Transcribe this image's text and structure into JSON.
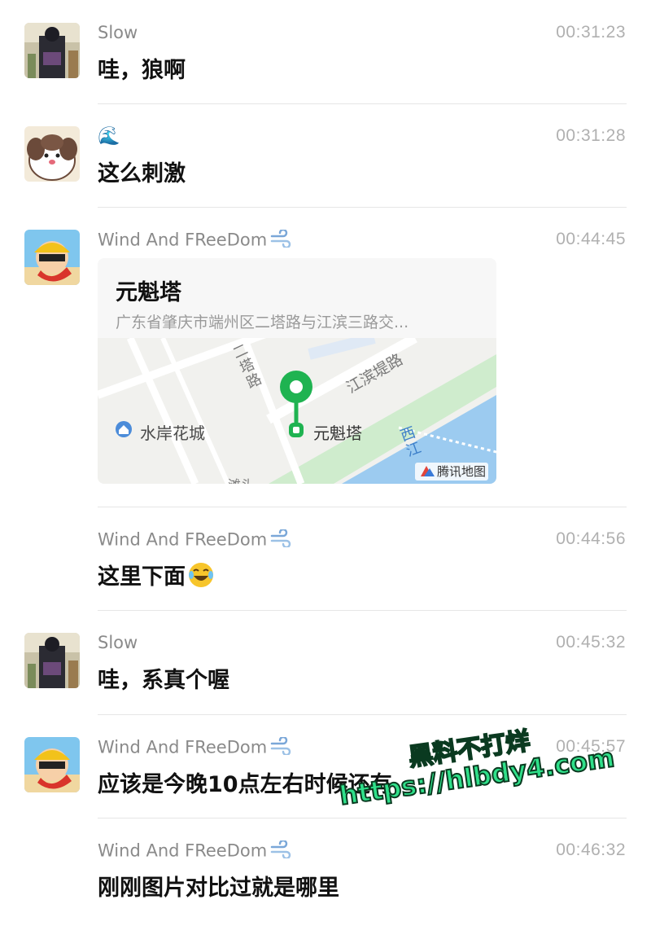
{
  "messages": [
    {
      "sender": "Slow",
      "time": "00:31:23",
      "text": "哇，狼啊"
    },
    {
      "sender": "🌊",
      "time": "00:31:28",
      "text": "这么刺激"
    },
    {
      "sender": "Wind And FReeDom",
      "time": "00:44:45",
      "location": {
        "name": "元魁塔",
        "address": "广东省肇庆市端州区二塔路与江滨三路交...",
        "labels": {
          "poi": "水岸花城",
          "marker": "元魁塔",
          "road1": "江滨堤路",
          "road2": "二塔路",
          "river": "西江",
          "brand": "腾讯地图",
          "partial1": "滩头"
        }
      }
    },
    {
      "sender": "Wind And FReeDom",
      "time": "00:44:56",
      "text": "这里下面"
    },
    {
      "sender": "Slow",
      "time": "00:45:32",
      "text": "哇，系真个喔"
    },
    {
      "sender": "Wind And FReeDom",
      "time": "00:45:57",
      "text": "应该是今晚10点左右时候还有"
    },
    {
      "sender": "Wind And FReeDom",
      "time": "00:46:32",
      "text": "刚刚图片对比过就是哪里"
    }
  ],
  "watermark": {
    "line1": "黑料不打烊",
    "line2": "https://hlbdy4.com"
  },
  "colors": {
    "accent_green": "#2fe08a",
    "map_water": "#9ccbf0",
    "map_marker": "#1fb351"
  }
}
